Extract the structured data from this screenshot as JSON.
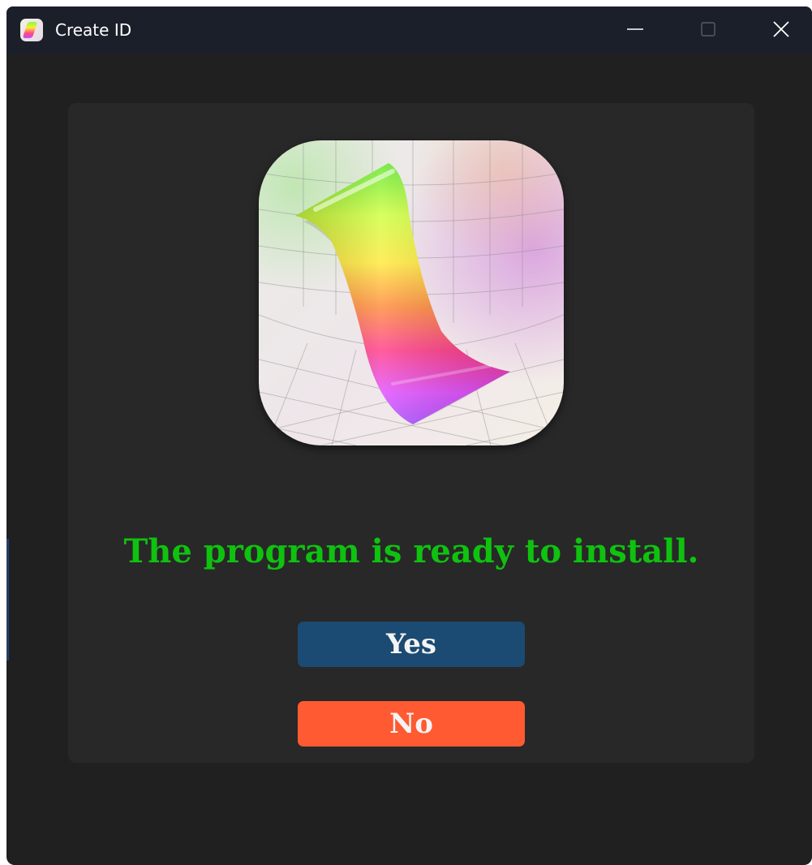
{
  "window": {
    "title": "Create ID",
    "app_icon": "graphing-ribbon-app-icon",
    "controls": {
      "minimize_icon": "minimize-icon",
      "maximize_icon": "maximize-icon",
      "close_icon": "close-icon"
    }
  },
  "main": {
    "hero_icon": "graphing-ribbon-logo-icon",
    "message": "The program is ready to install.",
    "yes_label": "Yes",
    "no_label": "No"
  },
  "colors": {
    "window_bg": "#202020",
    "titlebar_bg": "#1b1f29",
    "panel_bg": "#282828",
    "message_text": "#0fc20f",
    "yes_button": "#1b4a72",
    "no_button": "#ff5a32",
    "button_text": "#f4f4f4"
  }
}
